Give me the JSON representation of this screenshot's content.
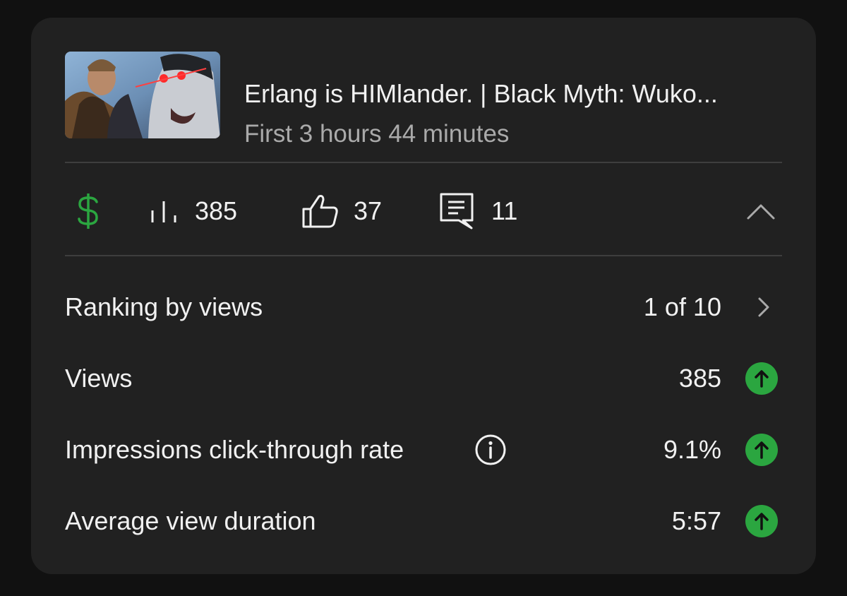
{
  "video": {
    "title": "Erlang is HIMlander. | Black Myth: Wuko...",
    "subtitle": "First 3 hours 44 minutes",
    "thumbnail_icon": "video-thumbnail"
  },
  "stats": {
    "monetization_icon": "dollar-icon",
    "monetization_color": "#2ba640",
    "views_icon": "bar-chart-icon",
    "views": "385",
    "likes_icon": "thumbs-up-icon",
    "likes": "37",
    "comments_icon": "comment-icon",
    "comments": "11",
    "collapse_icon": "chevron-up-icon"
  },
  "metrics": [
    {
      "label": "Ranking by views",
      "value": "1 of 10",
      "indicator": "chevron-right-icon"
    },
    {
      "label": "Views",
      "value": "385",
      "indicator": "arrow-up-circle-icon"
    },
    {
      "label": "Impressions click-through rate",
      "value": "9.1%",
      "indicator": "arrow-up-circle-icon",
      "info_icon": "info-icon"
    },
    {
      "label": "Average view duration",
      "value": "5:57",
      "indicator": "arrow-up-circle-icon"
    }
  ],
  "colors": {
    "background": "#111111",
    "card": "#212121",
    "text": "#f1f1f1",
    "secondary_text": "#aaaaaa",
    "accent_green": "#2ba640"
  }
}
